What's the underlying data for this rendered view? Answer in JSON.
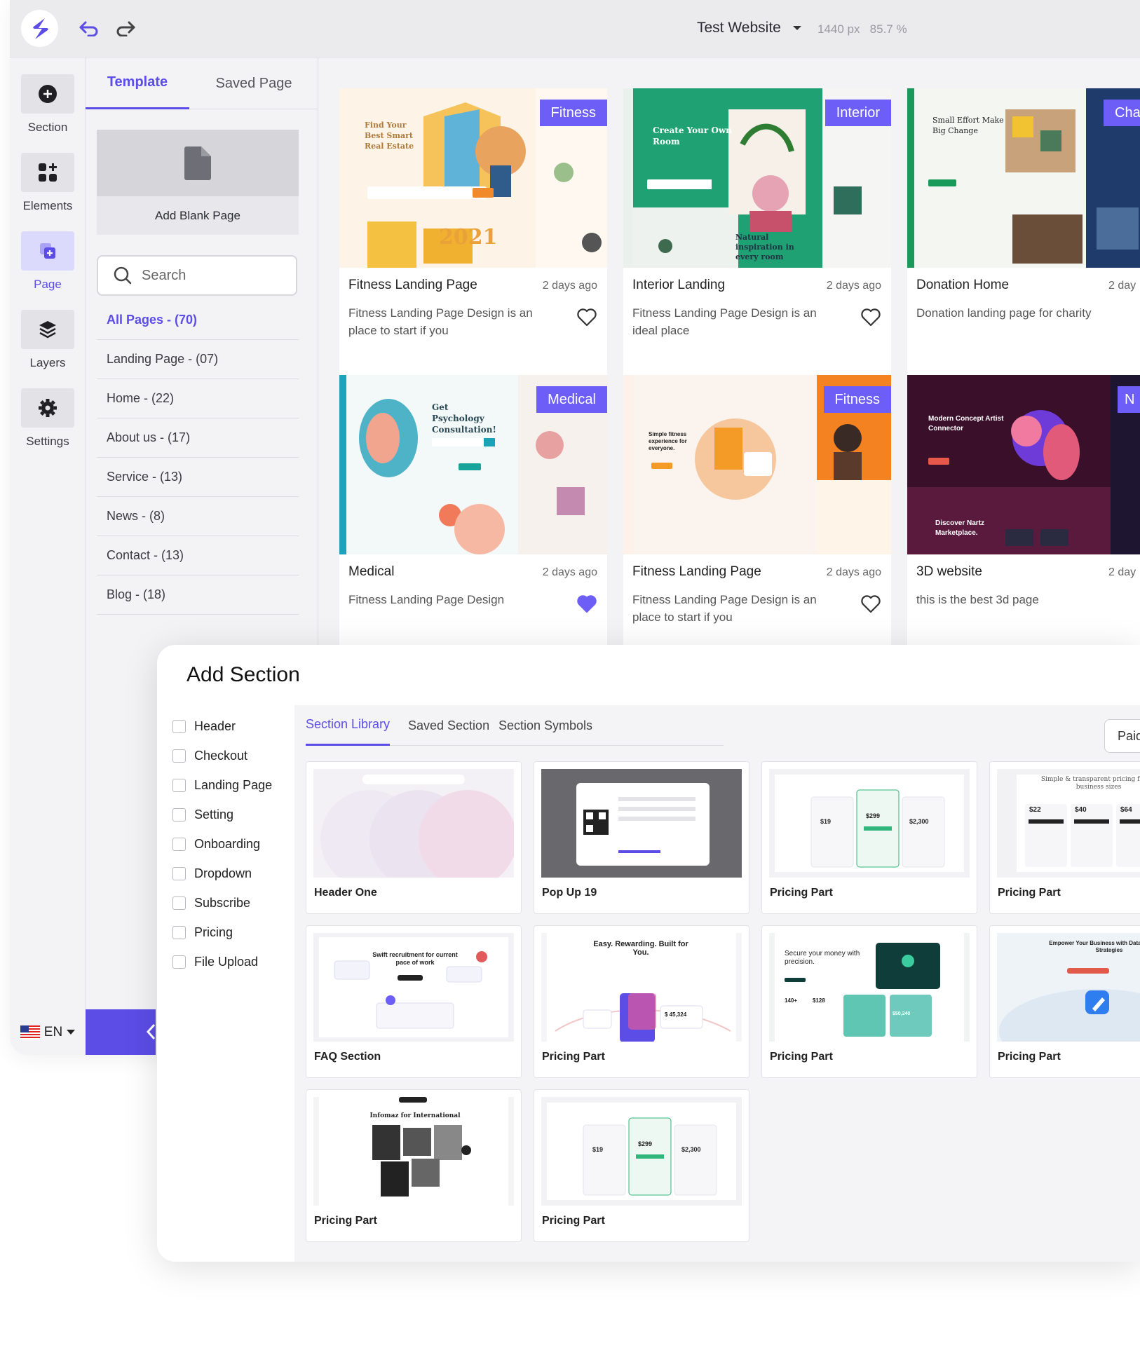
{
  "topbar": {
    "site_name": "Test Website",
    "meta": "1440 px   85.7 %"
  },
  "rail": [
    {
      "label": "Section"
    },
    {
      "label": "Elements"
    },
    {
      "label": "Page"
    },
    {
      "label": "Layers"
    },
    {
      "label": "Settings"
    }
  ],
  "panel": {
    "tabs": [
      "Template",
      "Saved Page"
    ],
    "blank_page": "Add Blank Page",
    "search_placeholder": "Search",
    "categories": [
      "All Pages - (70)",
      "Landing Page - (07)",
      "Home - (22)",
      "About us - (17)",
      "Service - (13)",
      "News - (8)",
      "Contact - (13)",
      "Blog - (18)"
    ]
  },
  "language": "EN",
  "templates": [
    {
      "badge": "Fitness",
      "title": "Fitness Landing Page",
      "date": "2 days ago",
      "desc": "Fitness Landing Page Design is an place to start if you",
      "liked": false
    },
    {
      "badge": "Interior",
      "title": "Interior Landing",
      "date": "2 days ago",
      "desc": "Fitness Landing Page Design is an ideal place",
      "liked": false
    },
    {
      "badge": "Char",
      "title": "Donation Home",
      "date": "2 day",
      "desc": "Donation landing page for charity",
      "liked": false
    },
    {
      "badge": "Medical",
      "title": "Medical",
      "date": "2 days ago",
      "desc": "Fitness Landing Page Design",
      "liked": true
    },
    {
      "badge": "Fitness",
      "title": "Fitness Landing Page",
      "date": "2 days ago",
      "desc": "Fitness Landing Page Design is an place to start if you",
      "liked": false
    },
    {
      "badge": "N",
      "title": "3D website",
      "date": "2 day",
      "desc": "this is the best 3d page",
      "liked": false
    }
  ],
  "thumb_text": {
    "t1": "Find Your Best Smart Real Estate",
    "t1b": "2021",
    "t2": "Create Your Own Room",
    "t2b": "Natural inspiration in every room",
    "t3": "Small Effort Make Big Change",
    "t4": "Get Psychology Consultation!",
    "t5": "Simple fitness experience for everyone.",
    "t6": "Modern Concept Artist Connector",
    "t6b": "Discover Nartz Marketplace."
  },
  "add_section": {
    "title": "Add Section",
    "filters": [
      "Header",
      "Checkout",
      "Landing Page",
      "Setting",
      "Onboarding",
      "Dropdown",
      "Subscribe",
      "Pricing",
      "File Upload"
    ],
    "tabs": [
      "Section Library",
      "Saved Section",
      "Section Symbols"
    ],
    "paid_label": "Paid",
    "sections": [
      "Header One",
      "Pop Up 19",
      "Pricing Part",
      "Pricing Part",
      "FAQ Section",
      "Pricing Part",
      "Pricing Part",
      "Pricing Part",
      "Pricing Part",
      "Pricing Part"
    ],
    "thumb_text": {
      "s3_prices": [
        "$19",
        "$299",
        "$2,300"
      ],
      "s4_title": "Simple & transparent pricing for all business sizes",
      "s4_prices": [
        "$22",
        "$40",
        "$64"
      ],
      "s5_title": "Swift recruitment for current pace of work",
      "s6_title": "Easy. Rewarding. Built for You.",
      "s6_amount": "$ 45,324",
      "s7_title": "Secure your money with precision.",
      "s7_stats": [
        "140+",
        "$128",
        "$50,240"
      ],
      "s8_title": "Empower Your Business with Data-Driven Ad Strategies",
      "s9_title": "Infomaz for International",
      "s10_prices": [
        "$19",
        "$299",
        "$2,300"
      ]
    }
  },
  "colors": {
    "accent": "#5b4de6",
    "badge": "#6d5ef7"
  }
}
